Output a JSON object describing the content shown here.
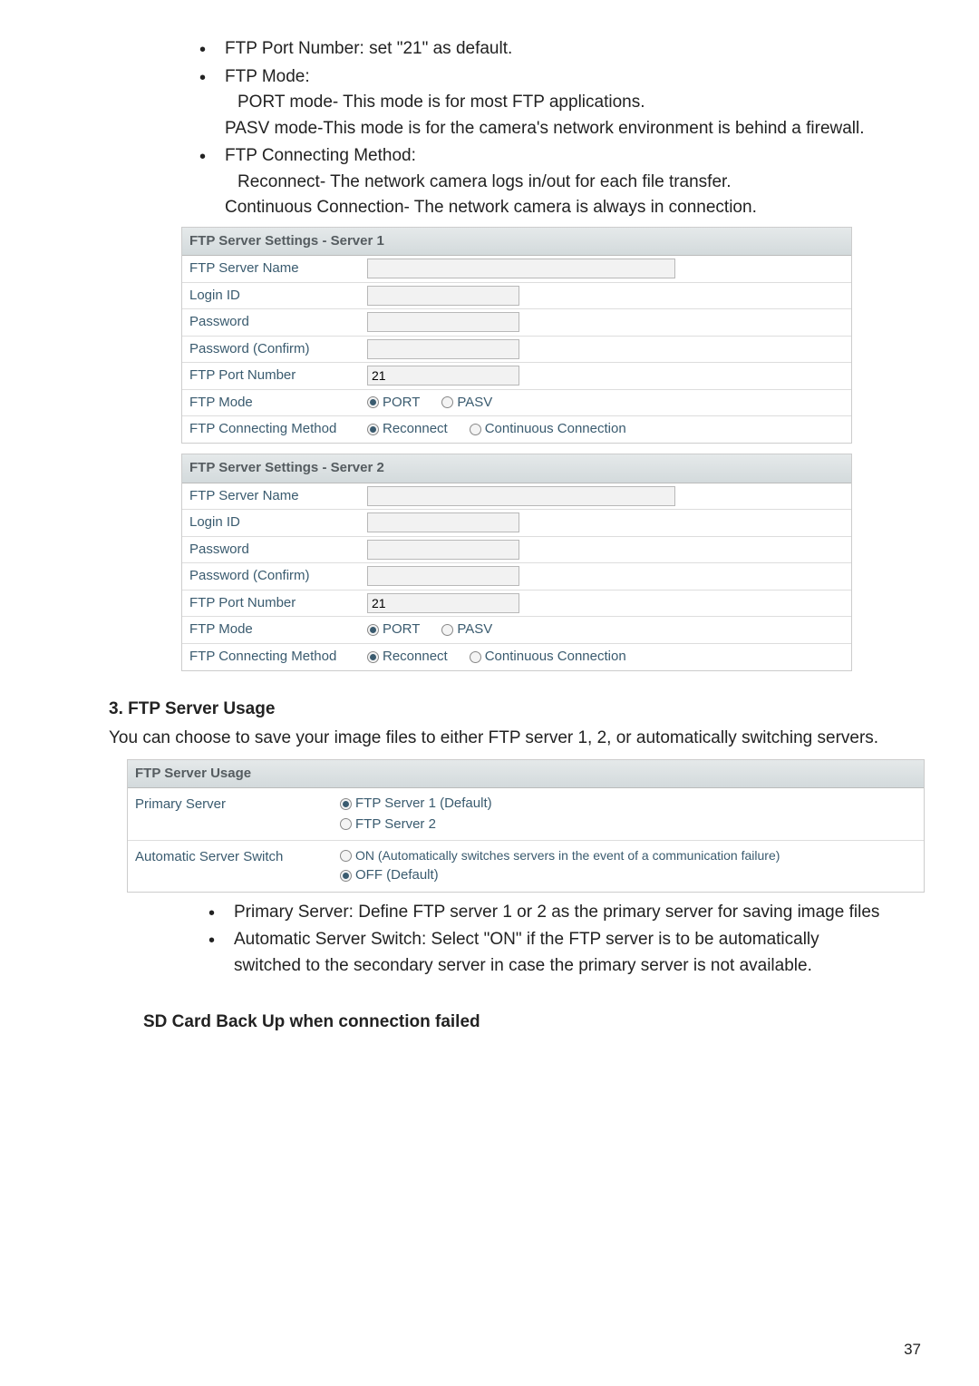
{
  "top_bullets": {
    "b1": "FTP Port Number: set \"21\" as default.",
    "b2": "FTP Mode:",
    "b2_sub1": "PORT mode- This mode is for most FTP applications.",
    "b2_sub2": "PASV mode-This mode is for the camera's network environment is behind a firewall.",
    "b3": "FTP Connecting Method:",
    "b3_sub1": "Reconnect- The network camera logs in/out for each file transfer.",
    "b3_sub2": "Continuous Connection- The network camera is always in connection."
  },
  "server1": {
    "header": "FTP Server Settings - Server 1",
    "name_lbl": "FTP Server Name",
    "name_val": "",
    "login_lbl": "Login ID",
    "login_val": "",
    "pwd_lbl": "Password",
    "pwd_val": "",
    "pwdc_lbl": "Password (Confirm)",
    "pwdc_val": "",
    "port_lbl": "FTP Port Number",
    "port_val": "21",
    "mode_lbl": "FTP Mode",
    "mode_port": "PORT",
    "mode_pasv": "PASV",
    "conn_lbl": "FTP Connecting Method",
    "conn_rec": "Reconnect",
    "conn_cont": "Continuous Connection"
  },
  "server2": {
    "header": "FTP Server Settings - Server 2",
    "name_lbl": "FTP Server Name",
    "name_val": "",
    "login_lbl": "Login ID",
    "login_val": "",
    "pwd_lbl": "Password",
    "pwd_val": "",
    "pwdc_lbl": "Password (Confirm)",
    "pwdc_val": "",
    "port_lbl": "FTP Port Number",
    "port_val": "21",
    "mode_lbl": "FTP Mode",
    "mode_port": "PORT",
    "mode_pasv": "PASV",
    "conn_lbl": "FTP Connecting Method",
    "conn_rec": "Reconnect",
    "conn_cont": "Continuous Connection"
  },
  "usage_heading": "3.  FTP Server Usage",
  "usage_text": "You can choose to save your image files to either FTP server 1, 2, or automatically switching servers.",
  "usage": {
    "header": "FTP Server Usage",
    "primary_lbl": "Primary Server",
    "primary_opt1": "FTP Server 1 (Default)",
    "primary_opt2": "FTP Server 2",
    "auto_lbl": "Automatic Server Switch",
    "auto_opt1": "ON (Automatically switches servers in the event of a communication failure)",
    "auto_opt2": "OFF (Default)"
  },
  "usage_bullets": {
    "b1": "Primary Server: Define FTP server 1 or 2 as the primary server for saving image files",
    "b2": "Automatic Server Switch: Select \"ON\" if the FTP server is to be automatically switched to the secondary server in case the primary server is not available."
  },
  "sd_heading": "SD Card Back Up when connection failed",
  "page_number": "37"
}
